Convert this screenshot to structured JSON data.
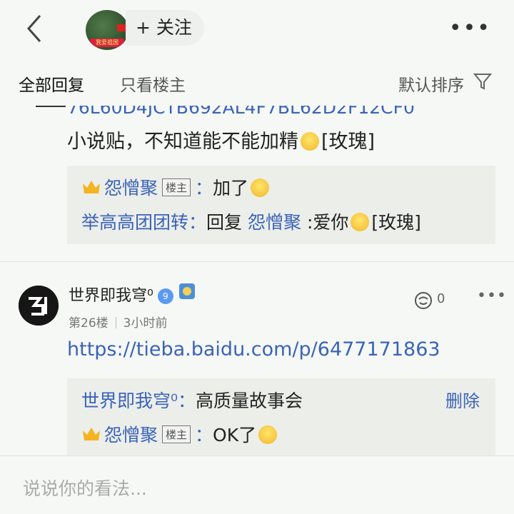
{
  "header": {
    "follow_label": "+ 关注",
    "avatar_tag": "我爱祖国"
  },
  "tabs": {
    "all_replies": "全部回复",
    "only_owner": "只看楼主",
    "sort": "默认排序"
  },
  "post1": {
    "clipped_line": "76L60D4JCTB692AL4F7BL62D2F12CF0",
    "text": "小说贴，不知道能不能加精",
    "text_suffix": "[玫瑰]",
    "replies": [
      {
        "user": "怨憎聚",
        "badge": "楼主",
        "colon": "：",
        "text": "加了"
      },
      {
        "user": "举高高团团转",
        "colon": "：",
        "prefix": "回复",
        "target": "怨憎聚",
        "text": ":爱你",
        "suffix": "[玫瑰]"
      }
    ]
  },
  "floor26": {
    "username": "世界即我穹⁰",
    "level": "9",
    "floor": "第26楼",
    "time": "3小时前",
    "like_count": "0",
    "link": "https://tieba.baidu.com/p/6477171863",
    "replies": [
      {
        "user": "世界即我穹⁰",
        "colon": "：",
        "text": "高质量故事会",
        "action": "删除"
      },
      {
        "user": "怨憎聚",
        "badge": "楼主",
        "colon": "：",
        "text": "OK了"
      }
    ]
  },
  "bottom": {
    "placeholder": "说说你的看法..."
  }
}
